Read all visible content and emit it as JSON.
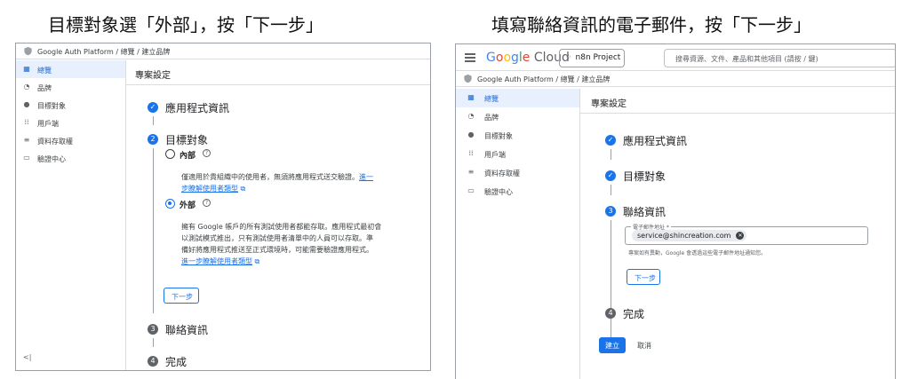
{
  "captions": {
    "left": "目標對象選「外部」，按「下一步」",
    "right": "填寫聯絡資訊的電子郵件，按「下一步」"
  },
  "topbar": {
    "logo": {
      "G": "G",
      "o1": "o",
      "o2": "o",
      "g": "g",
      "l": "l",
      "e": "e",
      "cloud": "Cloud"
    },
    "project": "n8n Project",
    "search_placeholder": "搜尋資源、文件、產品和其他項目 (請按 / 鍵)"
  },
  "breadcrumb": {
    "text": "Google Auth Platform / 總覽 / 建立品牌"
  },
  "sidebar": {
    "items": [
      {
        "icon": "overview-icon",
        "label": "總覽"
      },
      {
        "icon": "palette-icon",
        "label": "品牌"
      },
      {
        "icon": "person-icon",
        "label": "目標對象"
      },
      {
        "icon": "grid-icon",
        "label": "用戶端"
      },
      {
        "icon": "data-access-icon",
        "label": "資料存取權"
      },
      {
        "icon": "verification-icon",
        "label": "驗證中心"
      }
    ],
    "collapse": "<|"
  },
  "main": {
    "title": "專案設定",
    "steps": [
      {
        "number": "1",
        "label": "應用程式資訊"
      },
      {
        "number": "2",
        "label": "目標對象"
      },
      {
        "number": "3",
        "label": "聯絡資訊"
      },
      {
        "number": "4",
        "label": "完成"
      }
    ],
    "audience": {
      "internal_label": "內部",
      "internal_desc_1": "僅適用於貴組織中的使用者，無須將應用程式送交驗證。",
      "internal_link_1": "進一",
      "internal_link_2": "步瞭解使用者類型",
      "external_label": "外部",
      "external_desc_1": "擁有 Google 帳戶的所有測試使用者都能存取。應用程式最初會",
      "external_desc_2": "以測試模式推出，只有測試使用者清單中的人員可以存取。準",
      "external_desc_3": "備好將應用程式推送至正式環境時，可能需要驗證應用程式。",
      "external_link": "進一步瞭解使用者類型"
    },
    "contact": {
      "field_label": "電子郵件地址 *",
      "email": "service@shincreation.com",
      "helper": "專案如有異動，Google 會透過這些電子郵件地址通知您。"
    },
    "next_button": "下一步",
    "create_button": "建立",
    "cancel_button": "取消"
  }
}
